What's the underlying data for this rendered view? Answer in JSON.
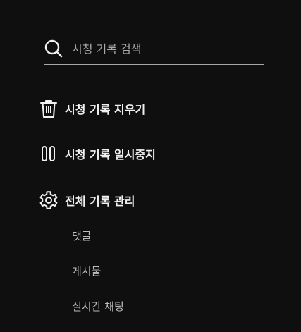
{
  "search": {
    "placeholder": "시청 기록 검색",
    "value": "",
    "icon": "search-icon"
  },
  "actions": [
    {
      "label": "시청 기록 지우기",
      "icon": "trash-icon"
    },
    {
      "label": "시청 기록 일시중지",
      "icon": "pause-icon"
    },
    {
      "label": "전체 기록 관리",
      "icon": "gear-icon"
    }
  ],
  "manage_items": [
    {
      "label": "댓글"
    },
    {
      "label": "게시물"
    },
    {
      "label": "실시간 채팅"
    }
  ],
  "colors": {
    "background": "#0f0f0f",
    "text": "#f1f1f1",
    "secondary_text": "#bdbdbd",
    "divider": "#a8a8a8"
  }
}
